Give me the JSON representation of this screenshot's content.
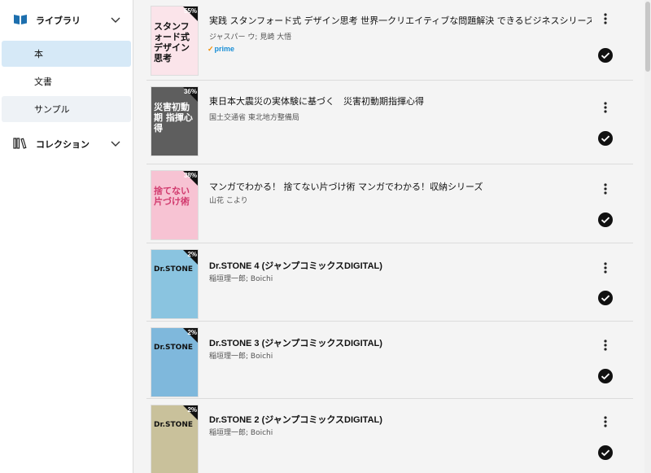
{
  "sidebar": {
    "library": {
      "label": "ライブラリ",
      "icon": "book-open-icon"
    },
    "items": [
      {
        "label": "本"
      },
      {
        "label": "文書"
      },
      {
        "label": "サンプル"
      }
    ],
    "collection": {
      "label": "コレクション",
      "icon": "books-shelf-icon"
    }
  },
  "books": [
    {
      "title": "実践 スタンフォード式 デザイン思考 世界一クリエイティブな問題解決 できるビジネスシリーズ",
      "author": "ジャスパー ウ; 見崎 大悟",
      "progress": "55%",
      "prime": "prime",
      "cover_text": "スタンフォード式 デザイン 思考",
      "cover_color": "#fbe4ea"
    },
    {
      "title": "東日本大震災の実体験に基づく　災害初動期指揮心得",
      "author": "国土交通省 東北地方整備局",
      "progress": "36%",
      "cover_text": "災害初動期 指揮心得",
      "cover_color": "#5e5e5e"
    },
    {
      "title": "マンガでわかる！ 捨てない片づけ術 マンガでわかる！収納シリーズ",
      "author": "山花 こより",
      "progress": "38%",
      "cover_text": "捨てない 片づけ術",
      "cover_color": "#f7c3d3"
    },
    {
      "title": "Dr.STONE 4 (ジャンプコミックスDIGITAL)",
      "author": "稲垣理一郎; Boichi",
      "progress": "2%",
      "cover_text": "Dr.STONE",
      "cover_color": "#8ac4e0"
    },
    {
      "title": "Dr.STONE 3 (ジャンプコミックスDIGITAL)",
      "author": "稲垣理一郎; Boichi",
      "progress": "2%",
      "cover_text": "Dr.STONE",
      "cover_color": "#7fb8dc"
    },
    {
      "title": "Dr.STONE 2 (ジャンプコミックスDIGITAL)",
      "author": "稲垣理一郎; Boichi",
      "progress": "2%",
      "cover_text": "Dr.STONE",
      "cover_color": "#c9c19b"
    }
  ],
  "colors": {
    "selected": "#d6e9f7",
    "accent_prime": "#1a8fd6",
    "library_icon": "#1d6fae"
  }
}
